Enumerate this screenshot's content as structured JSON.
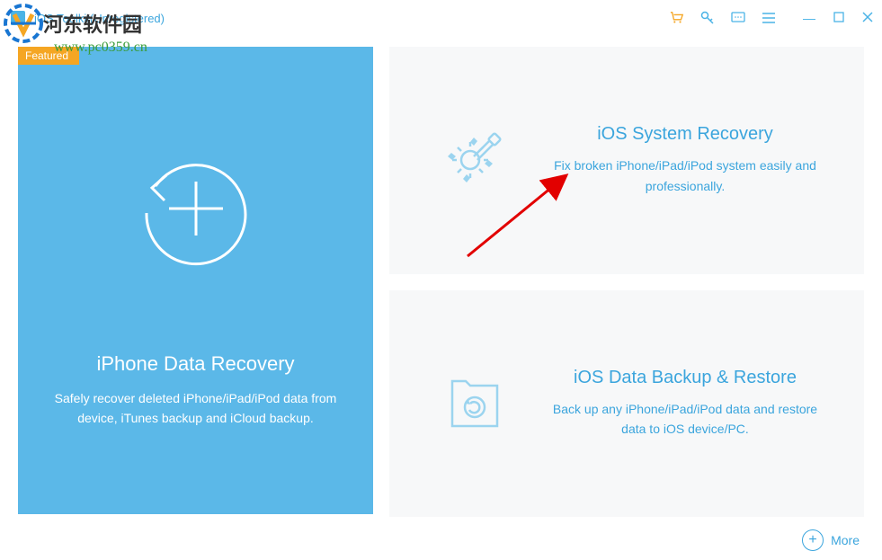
{
  "window": {
    "title": "iOS Toolkit(Unregistered)"
  },
  "watermark": {
    "text": "河东软件园",
    "url": "www.pc0359.cn"
  },
  "cards": {
    "featured_label": "Featured",
    "data_recovery": {
      "title": "iPhone Data Recovery",
      "desc": "Safely recover deleted iPhone/iPad/iPod data from device, iTunes backup and iCloud backup."
    },
    "system_recovery": {
      "title": "iOS System Recovery",
      "desc": "Fix broken iPhone/iPad/iPod system easily and professionally."
    },
    "backup_restore": {
      "title": "iOS Data Backup & Restore",
      "desc": "Back up any iPhone/iPad/iPod data and restore data to iOS device/PC."
    }
  },
  "footer": {
    "more_label": "More"
  },
  "colors": {
    "accent": "#3ba5dd",
    "card_blue": "#5bb8e8",
    "card_gray": "#f7f8f9",
    "featured": "#f5a623"
  }
}
